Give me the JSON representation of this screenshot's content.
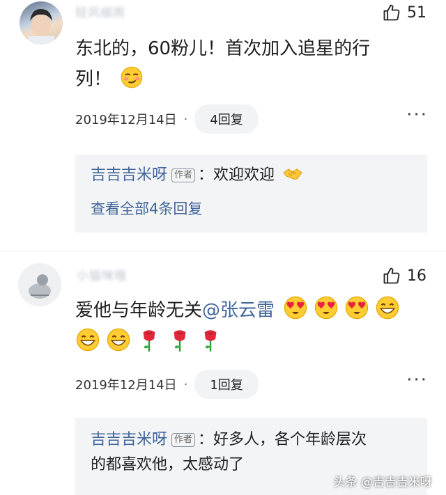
{
  "comments": [
    {
      "username": "轻风细雨",
      "likes": "51",
      "text": "东北的，60粉儿！首次加入追星的行列！",
      "text_line1": "东北的，60粉儿！首次加入追星的行",
      "text_line2": "列！",
      "date": "2019年12月14日",
      "separator": "·",
      "reply_count": "4回复",
      "replies": [
        {
          "author": "吉吉吉米呀",
          "tag": "作者",
          "text": "：欢迎欢迎"
        }
      ],
      "view_all": "查看全部4条回复"
    },
    {
      "username": "小猫咪哦",
      "likes": "16",
      "text_prefix": "爱他与年龄无关",
      "mention": "@张云雷",
      "date": "2019年12月14日",
      "separator": "·",
      "reply_count": "1回复",
      "replies": [
        {
          "author": "吉吉吉米呀",
          "tag": "作者",
          "text_line1": "：好多人，各个年龄层次",
          "text_line2": "的都喜欢他，太感动了"
        }
      ]
    }
  ],
  "more_icon": "···",
  "watermark": "头条 @吉吉吉米呀",
  "colors": {
    "link": "#406599",
    "reply_bg": "#f3f4f6",
    "pill_bg": "#f2f3f5"
  },
  "icons": [
    "thumbs-up-icon",
    "more-icon",
    "smirk-emoji",
    "heart-eyes-emoji",
    "grin-emoji",
    "rose-emoji",
    "handshake-emoji"
  ]
}
